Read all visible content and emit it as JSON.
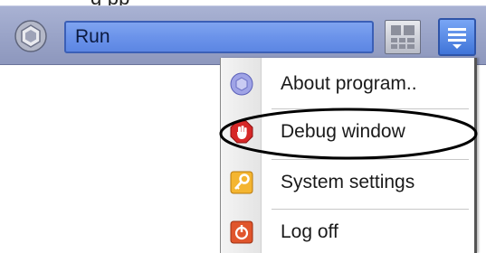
{
  "cropped_heading": "g                     pp",
  "toolbar": {
    "logo_icon": "hexagon-logo-icon",
    "search_value": "Run",
    "layout_icon": "grid-layout-icon",
    "menu_icon": "hamburger-menu-icon"
  },
  "menu": {
    "items": [
      {
        "label": "About program..",
        "icon": "info-hexagon-icon",
        "color": "#7d7fd6"
      },
      {
        "label": "Debug window",
        "icon": "stop-hand-icon",
        "color": "#d62828"
      },
      {
        "label": "System settings",
        "icon": "key-icon",
        "color": "#e8a21a"
      },
      {
        "label": "Log off",
        "icon": "power-off-icon",
        "color": "#d9411f"
      }
    ],
    "highlighted_item": "Debug window"
  },
  "colors": {
    "toolbar_bg": "#9aa4c8",
    "field_bg": "#6b93ea",
    "callout_stroke": "#000000"
  }
}
